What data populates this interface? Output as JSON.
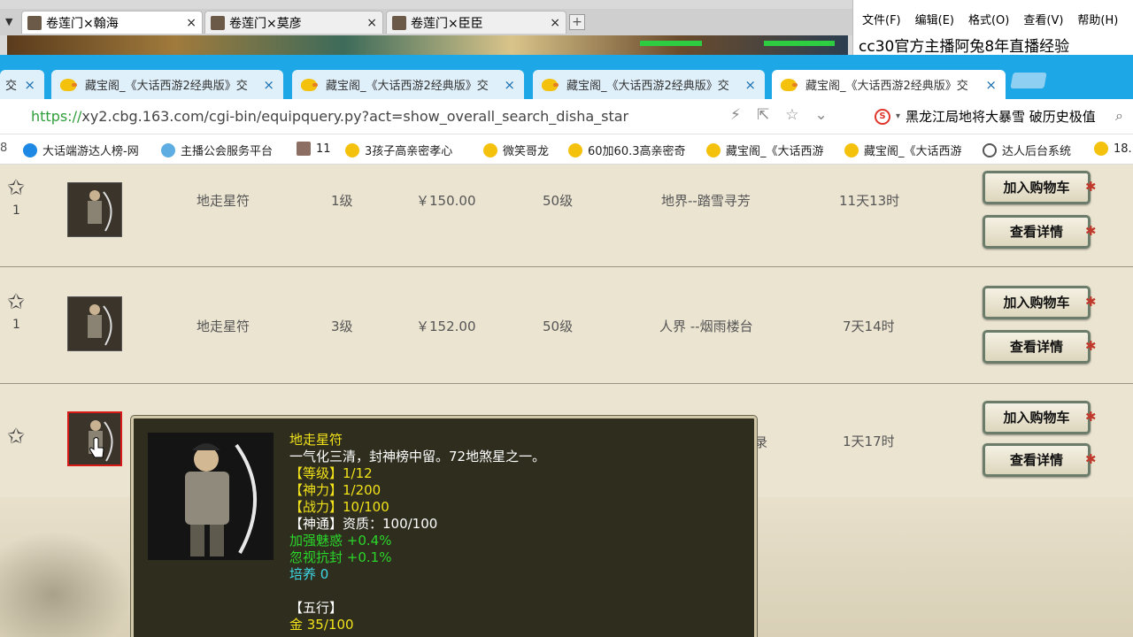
{
  "outer_tabs": [
    {
      "label": "卷莲门×翰海"
    },
    {
      "label": "卷莲门×莫彦"
    },
    {
      "label": "卷莲门×臣臣"
    }
  ],
  "outer_tab_close": "×",
  "notepad": {
    "menu": [
      "文件(F)",
      "编辑(E)",
      "格式(O)",
      "查看(V)",
      "帮助(H)"
    ],
    "text": "cc30官方主播阿兔8年直播经验"
  },
  "browser_tabs": [
    {
      "label": "交"
    },
    {
      "label": "藏宝阁_《大话西游2经典版》交"
    },
    {
      "label": "藏宝阁_《大话西游2经典版》交"
    },
    {
      "label": "藏宝阁_《大话西游2经典版》交"
    },
    {
      "label": "藏宝阁_《大话西游2经典版》交"
    }
  ],
  "tab_close": "×",
  "address": {
    "scheme": "https://",
    "rest": "xy2.cbg.163.com/cgi-bin/equipquery.py?act=show_overall_search_disha_star",
    "search_text": "黑龙江局地将大暴雪 破历史极值"
  },
  "bookmarks": [
    {
      "label": "大话端游达人榜-网"
    },
    {
      "label": "主播公会服务平台"
    },
    {
      "label": "11"
    },
    {
      "label": "3孩子高亲密孝心"
    },
    {
      "label": "微笑哥龙"
    },
    {
      "label": "60加60.3高亲密奇"
    },
    {
      "label": "藏宝阁_《大话西游"
    },
    {
      "label": "藏宝阁_《大话西游"
    },
    {
      "label": "达人后台系统"
    },
    {
      "label": "18."
    }
  ],
  "rows": [
    {
      "fav": "1",
      "name": "地走星符",
      "level": "1级",
      "price": "￥150.00",
      "req": "50级",
      "server": "地界--踏雪寻芳",
      "time": "11天13时"
    },
    {
      "fav": "1",
      "name": "地走星符",
      "level": "3级",
      "price": "￥152.00",
      "req": "50级",
      "server": "人界 --烟雨楼台",
      "time": "7天14时"
    },
    {
      "fav": "",
      "name": "",
      "level": "",
      "price": "",
      "req": "",
      "server": "",
      "time": "1天17时"
    }
  ],
  "buttons": {
    "add_cart": "加入购物车",
    "view_detail": "查看详情"
  },
  "tooltip": {
    "name": "地走星符",
    "desc": "一气化三清，封神榜中留。72地煞星之一。",
    "level": "【等级】1/12",
    "shenli": "【神力】1/200",
    "zhanli": "【战力】10/100",
    "shentong": "【神通】资质：100/100",
    "attr1": "加强魅惑 +0.4%",
    "attr2": "忽视抗封 +0.1%",
    "peiyang": "培养 0",
    "wuxing": "【五行】",
    "jin": "金 35/100"
  },
  "partial_server": "录"
}
